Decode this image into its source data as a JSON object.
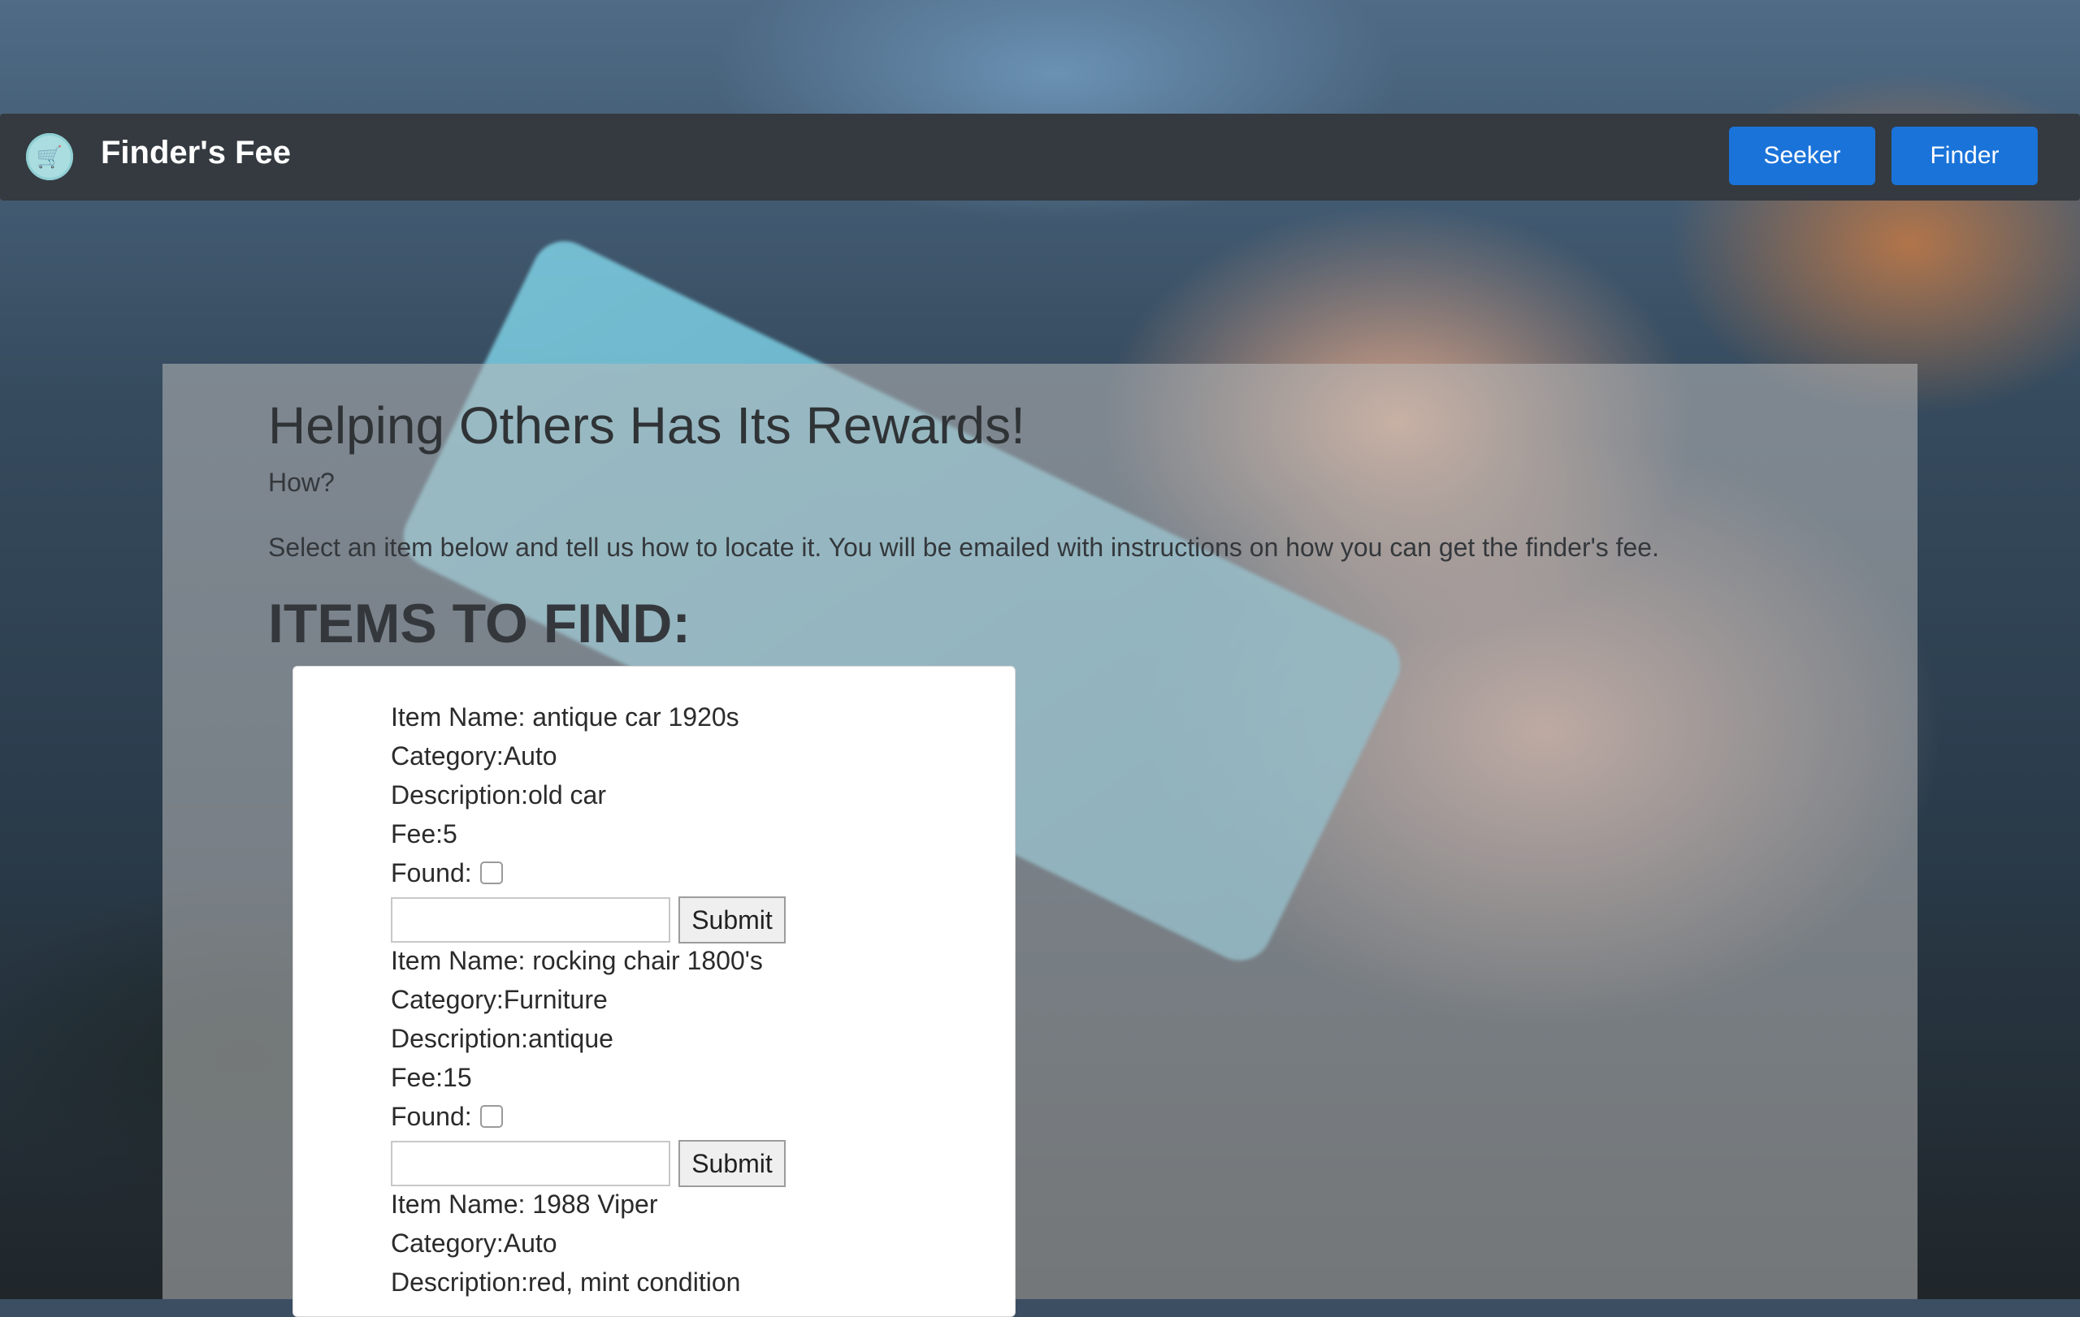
{
  "navbar": {
    "brand": "Finder's Fee",
    "logo_icon": "shopping-cart-icon",
    "buttons": {
      "seeker": "Seeker",
      "finder": "Finder"
    }
  },
  "jumbotron": {
    "title": "Helping Others Has Its Rewards!",
    "subtitle": "How?",
    "description": "Select an item below and tell us how to locate it. You will be emailed with instructions on how you can get the finder's fee.",
    "items_heading": "ITEMS TO FIND:"
  },
  "items": [
    {
      "name": "Item Name: antique car 1920s",
      "category": "Category:Auto",
      "description": "Description:old car",
      "fee": "Fee:5",
      "found_label": "Found:",
      "found_checked": false,
      "input_value": "",
      "submit_label": "Submit"
    },
    {
      "name": "Item Name: rocking chair 1800's",
      "category": "Category:Furniture",
      "description": "Description:antique",
      "fee": "Fee:15",
      "found_label": "Found:",
      "found_checked": false,
      "input_value": "",
      "submit_label": "Submit"
    },
    {
      "name": "Item Name: 1988 Viper",
      "category": "Category:Auto",
      "description": "Description:red, mint condition"
    }
  ],
  "colors": {
    "navbar_bg": "#343a40",
    "primary_button": "#1a73d9"
  }
}
